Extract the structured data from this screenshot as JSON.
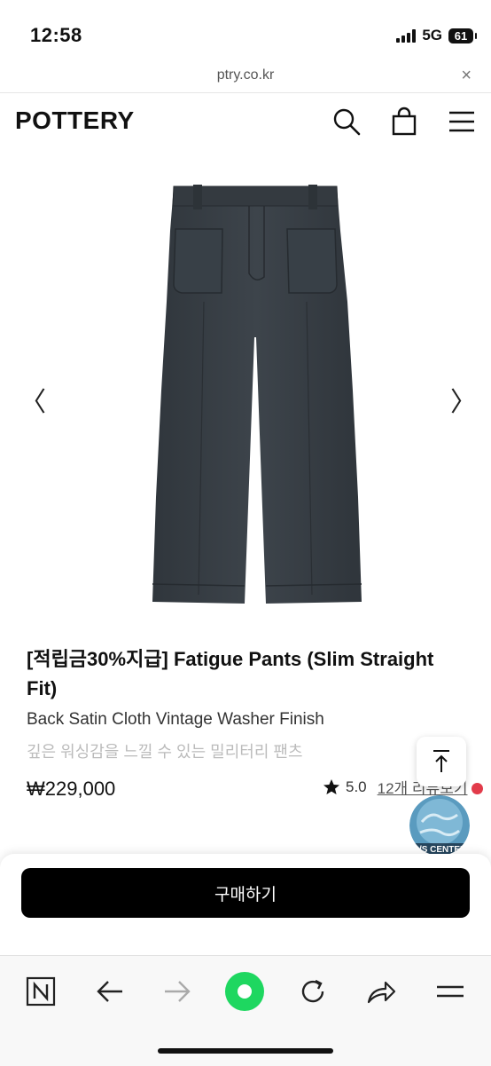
{
  "status_bar": {
    "time": "12:58",
    "network": "5G",
    "battery": "61"
  },
  "url_bar": {
    "url": "ptry.co.kr",
    "close_label": "×"
  },
  "header": {
    "logo": "POTTERY"
  },
  "gallery": {
    "prev_label": "〈",
    "next_label": "〉",
    "image_subject": "dark charcoal fatigue pants"
  },
  "product": {
    "title": "[적립금30%지급] Fatigue Pants (Slim Straight Fit)",
    "subtitle": "Back Satin Cloth Vintage Washer Finish",
    "description_kr": "깊은 워싱감을 느낄 수 있는 밀리터리 팬츠",
    "price": "₩229,000",
    "rating": "5.0",
    "reviews_link": "12개 리뷰보기"
  },
  "floating": {
    "cs_center_label": "C/S CENTER"
  },
  "buy": {
    "button_label": "구매하기"
  },
  "colors": {
    "accent_green": "#1ed760",
    "pants": "#3a4148",
    "red_dot": "#e23b4a"
  }
}
